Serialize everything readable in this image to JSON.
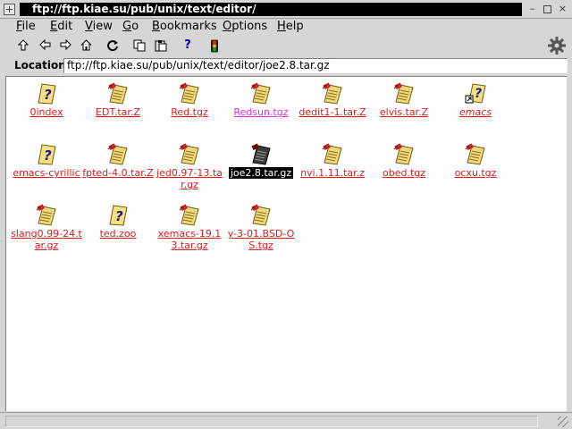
{
  "window": {
    "title": "ftp://ftp.kiae.su/pub/unix/text/editor/",
    "buttons": {
      "minimize": "–",
      "close": "×"
    }
  },
  "menu": {
    "items": [
      {
        "label": "File",
        "mnemonic": "F",
        "rest": "ile"
      },
      {
        "label": "Edit",
        "mnemonic": "E",
        "rest": "dit"
      },
      {
        "label": "View",
        "mnemonic": "V",
        "rest": "iew"
      },
      {
        "label": "Go",
        "mnemonic": "G",
        "rest": "o"
      },
      {
        "label": "Bookmarks",
        "mnemonic": "B",
        "rest": "ookmarks"
      },
      {
        "label": "Options",
        "mnemonic": "O",
        "rest": "ptions"
      },
      {
        "label": "Help",
        "mnemonic": "H",
        "rest": "elp"
      }
    ]
  },
  "toolbar": {
    "buttons": [
      "up-arrow-icon",
      "back-arrow-icon",
      "forward-arrow-icon",
      "home-icon",
      "reload-icon",
      "copy-icon",
      "paste-icon",
      "help-icon",
      "stop-icon"
    ],
    "help_glyph": "?"
  },
  "location": {
    "label": "Location:",
    "value": "ftp://ftp.kiae.su/pub/unix/text/editor/joe2.8.tar.gz"
  },
  "files": [
    {
      "name": "0index",
      "icon": "unknown-file-icon",
      "state": "normal"
    },
    {
      "name": "EDT.tar.Z",
      "icon": "archive-file-icon",
      "state": "normal"
    },
    {
      "name": "Red.tgz",
      "icon": "archive-file-icon",
      "state": "normal"
    },
    {
      "name": "Redsun.tgz",
      "icon": "archive-file-icon",
      "state": "visited"
    },
    {
      "name": "dedit1-1.tar.Z",
      "icon": "archive-file-icon",
      "state": "normal"
    },
    {
      "name": "elvis.tar.Z",
      "icon": "archive-file-icon",
      "state": "normal"
    },
    {
      "name": "emacs",
      "icon": "link-file-icon",
      "state": "italic"
    },
    {
      "name": "emacs-cyrillic",
      "icon": "unknown-file-icon",
      "state": "normal"
    },
    {
      "name": "fpted-4.0.tar.Z",
      "icon": "archive-file-icon",
      "state": "normal"
    },
    {
      "name": "jed0.97-13.tar.gz",
      "icon": "archive-file-icon",
      "state": "normal"
    },
    {
      "name": "joe2.8.tar.gz",
      "icon": "archive-file-icon",
      "state": "selected"
    },
    {
      "name": "nvi.1.11.tar.z",
      "icon": "archive-file-icon",
      "state": "normal"
    },
    {
      "name": "obed.tgz",
      "icon": "archive-file-icon",
      "state": "normal"
    },
    {
      "name": "ocxu.tgz",
      "icon": "archive-file-icon",
      "state": "normal"
    },
    {
      "name": "slang0.99-24.tar.gz",
      "icon": "archive-file-icon",
      "state": "normal"
    },
    {
      "name": "ted.zoo",
      "icon": "unknown-file-icon",
      "state": "normal"
    },
    {
      "name": "xemacs-19.13.tar.gz",
      "icon": "archive-file-icon",
      "state": "normal"
    },
    {
      "name": "y-3-01.BSD-OS.tgz",
      "icon": "archive-file-icon",
      "state": "normal"
    }
  ],
  "colors": {
    "link": "#e0191d",
    "visited": "#e030e0",
    "background": "#d6d6d6"
  }
}
